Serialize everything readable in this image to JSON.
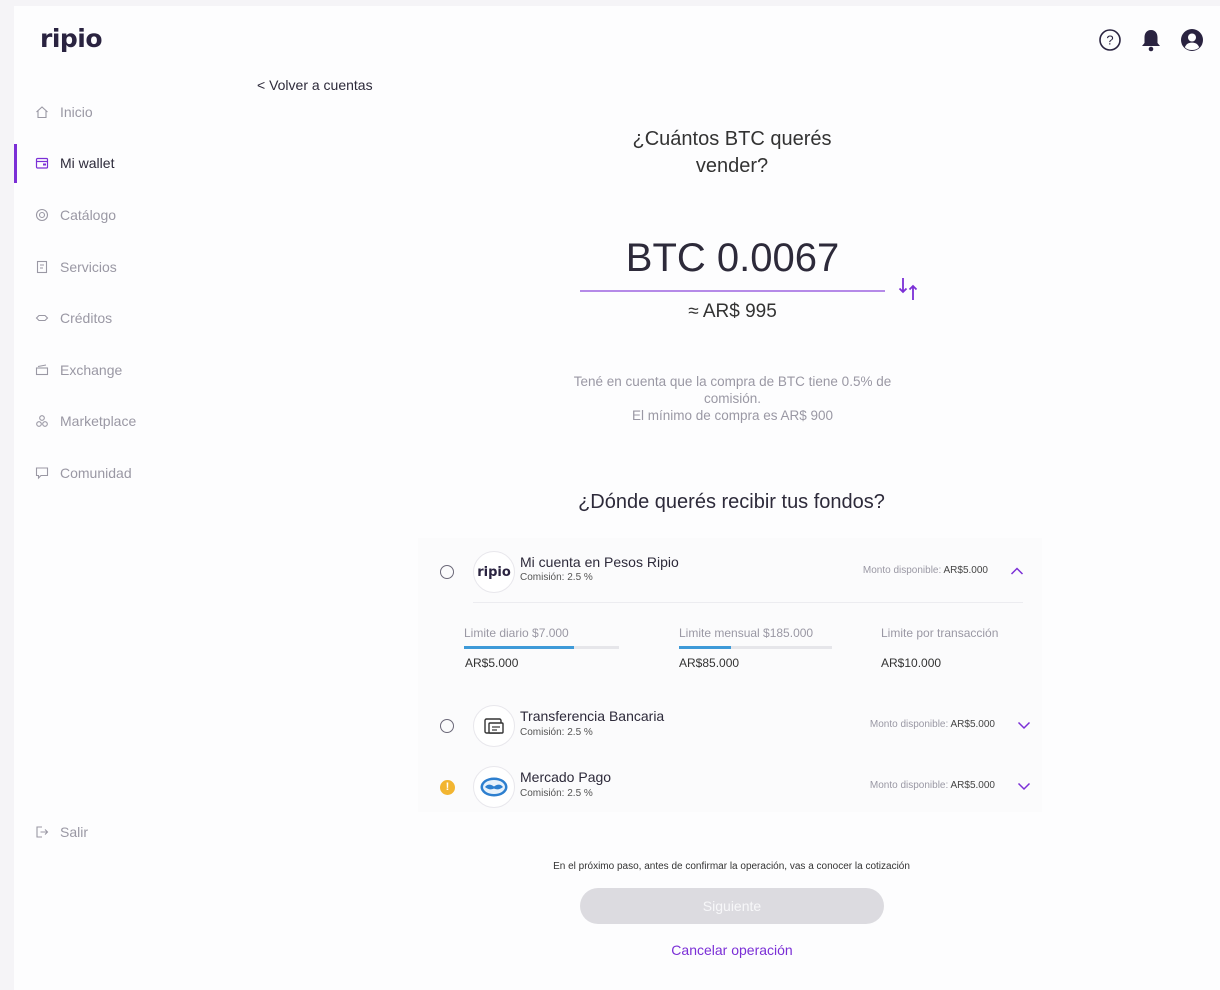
{
  "app": {
    "logo": "ripio"
  },
  "header": {
    "icons": [
      "help-icon",
      "bell-icon",
      "user-icon"
    ]
  },
  "sidebar": {
    "items": [
      {
        "label": "Inicio",
        "icon": "home-icon",
        "active": false
      },
      {
        "label": "Mi wallet",
        "icon": "wallet-icon",
        "active": true
      },
      {
        "label": "Catálogo",
        "icon": "catalog-icon",
        "active": false
      },
      {
        "label": "Servicios",
        "icon": "services-icon",
        "active": false
      },
      {
        "label": "Créditos",
        "icon": "credits-icon",
        "active": false
      },
      {
        "label": "Exchange",
        "icon": "exchange-icon",
        "active": false
      },
      {
        "label": "Marketplace",
        "icon": "marketplace-icon",
        "active": false
      },
      {
        "label": "Comunidad",
        "icon": "community-icon",
        "active": false
      }
    ],
    "logout": "Salir"
  },
  "main": {
    "back_link": "< Volver a cuentas",
    "question_line1": "¿Cuántos BTC querés",
    "question_line2": "vender?",
    "amount": "BTC 0.0067",
    "fiat_equivalent": "≈ AR$ 995",
    "note_line1": "Tené en cuenta que la compra de BTC tiene 0.5% de",
    "note_line2": "comisión.",
    "note_line3": "El mínimo  de compra es AR$ 900",
    "funds_question": "¿Dónde querés recibir tus fondos?",
    "options": [
      {
        "title": "Mi cuenta en Pesos Ripio",
        "commission": "Comisión: 2.5 %",
        "avail_label": "Monto disponible:",
        "avail_value": "AR$5.000",
        "expanded": true,
        "avatar_text": "ripio"
      },
      {
        "title": "Transferencia Bancaria",
        "commission": "Comisión: 2.5 %",
        "avail_label": "Monto disponible:",
        "avail_value": "AR$5.000",
        "expanded": false
      },
      {
        "title": "Mercado Pago",
        "commission": "Comisión: 2.5 %",
        "avail_label": "Monto disponible:",
        "avail_value": "AR$5.000",
        "expanded": false,
        "warning": "!"
      }
    ],
    "limits": [
      {
        "label": "Limite diario $7.000",
        "value": "AR$5.000",
        "progress": 0.71
      },
      {
        "label": "Limite mensual $185.000",
        "value": "AR$85.000",
        "progress": 0.34
      },
      {
        "label": "Limite por transacción",
        "value": "AR$10.000"
      }
    ],
    "next_note": "En el próximo paso, antes de confirmar la operación, vas a conocer la cotización",
    "next_button": "Siguiente",
    "cancel_link": "Cancelar operación"
  },
  "colors": {
    "accent": "#7b2fd6",
    "progress": "#3e9ad8",
    "warning": "#f2b531"
  }
}
